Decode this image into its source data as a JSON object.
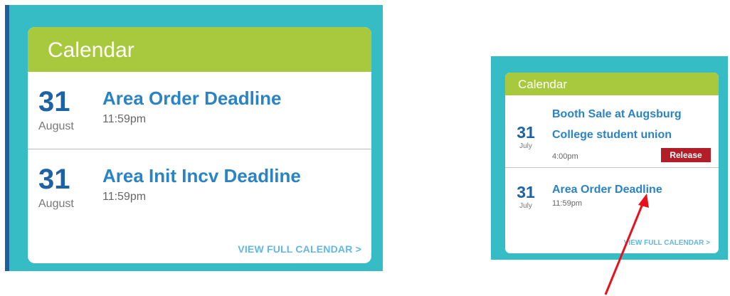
{
  "widget_large": {
    "header": "Calendar",
    "events": [
      {
        "day": "31",
        "month": "August",
        "title": "Area Order Deadline",
        "time": "11:59pm"
      },
      {
        "day": "31",
        "month": "August",
        "title": "Area Init Incv Deadline",
        "time": "11:59pm"
      }
    ],
    "view_full_calendar": "VIEW FULL CALENDAR >"
  },
  "widget_small": {
    "header": "Calendar",
    "events": [
      {
        "day": "31",
        "month": "July",
        "title": "Booth Sale at Augsburg College student union",
        "time": "4:00pm",
        "badge": "Release"
      },
      {
        "day": "31",
        "month": "July",
        "title": "Area Order Deadline",
        "time": "11:59pm"
      }
    ],
    "view_full_calendar": "VIEW FULL CALENDAR >"
  },
  "colors": {
    "teal_background": "#36bcc5",
    "header_green": "#a8c93d",
    "date_blue": "#1c62a4",
    "title_blue": "#2a83c4",
    "link_blue": "#62b8e2",
    "badge_red": "#b21e28",
    "arrow_red": "#e8101a"
  },
  "annotation": {
    "icon": "red-arrow-icon"
  }
}
